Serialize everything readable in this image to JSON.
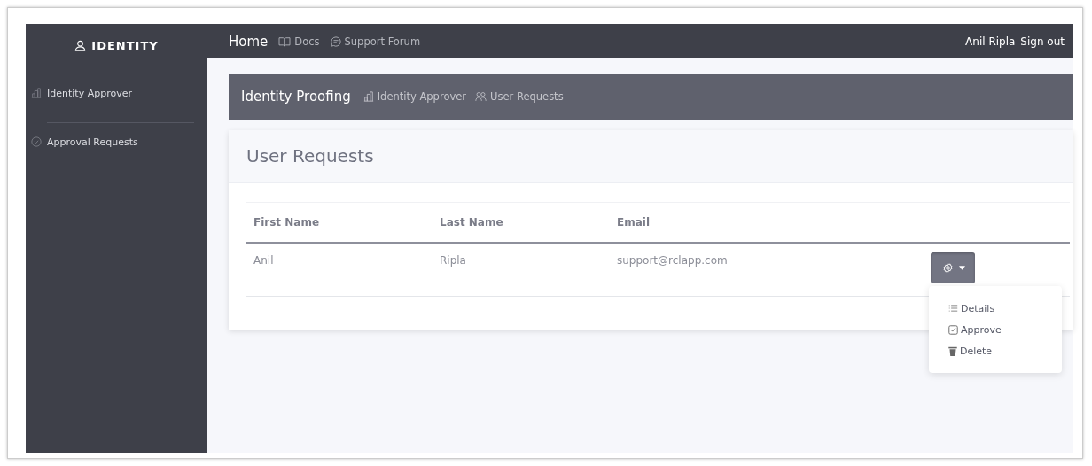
{
  "brand": {
    "title": "IDENTITY"
  },
  "topbar": {
    "links": [
      {
        "label": "Home",
        "kind": "home"
      },
      {
        "label": "Docs",
        "kind": "docs"
      },
      {
        "label": "Support Forum",
        "kind": "forum"
      }
    ],
    "user": "Anil Ripla",
    "signout": "Sign out"
  },
  "sidebar": {
    "items": [
      {
        "label": "Identity Approver",
        "kind": "approver"
      },
      {
        "label": "Approval Requests",
        "kind": "requests"
      }
    ]
  },
  "breadcrumb": {
    "title": "Identity Proofing",
    "items": [
      {
        "label": "Identity Approver",
        "kind": "approver"
      },
      {
        "label": "User Requests",
        "kind": "users"
      }
    ]
  },
  "card": {
    "title": "User Requests"
  },
  "table": {
    "columns": [
      "First Name",
      "Last Name",
      "Email"
    ],
    "rows": [
      {
        "cells": [
          "Anil",
          "Ripla",
          "support@rclapp.com"
        ]
      }
    ]
  },
  "action_menu": {
    "expanded": true,
    "items": [
      {
        "label": "Details",
        "kind": "details"
      },
      {
        "label": "Approve",
        "kind": "approve"
      },
      {
        "label": "Delete",
        "kind": "delete"
      }
    ]
  }
}
